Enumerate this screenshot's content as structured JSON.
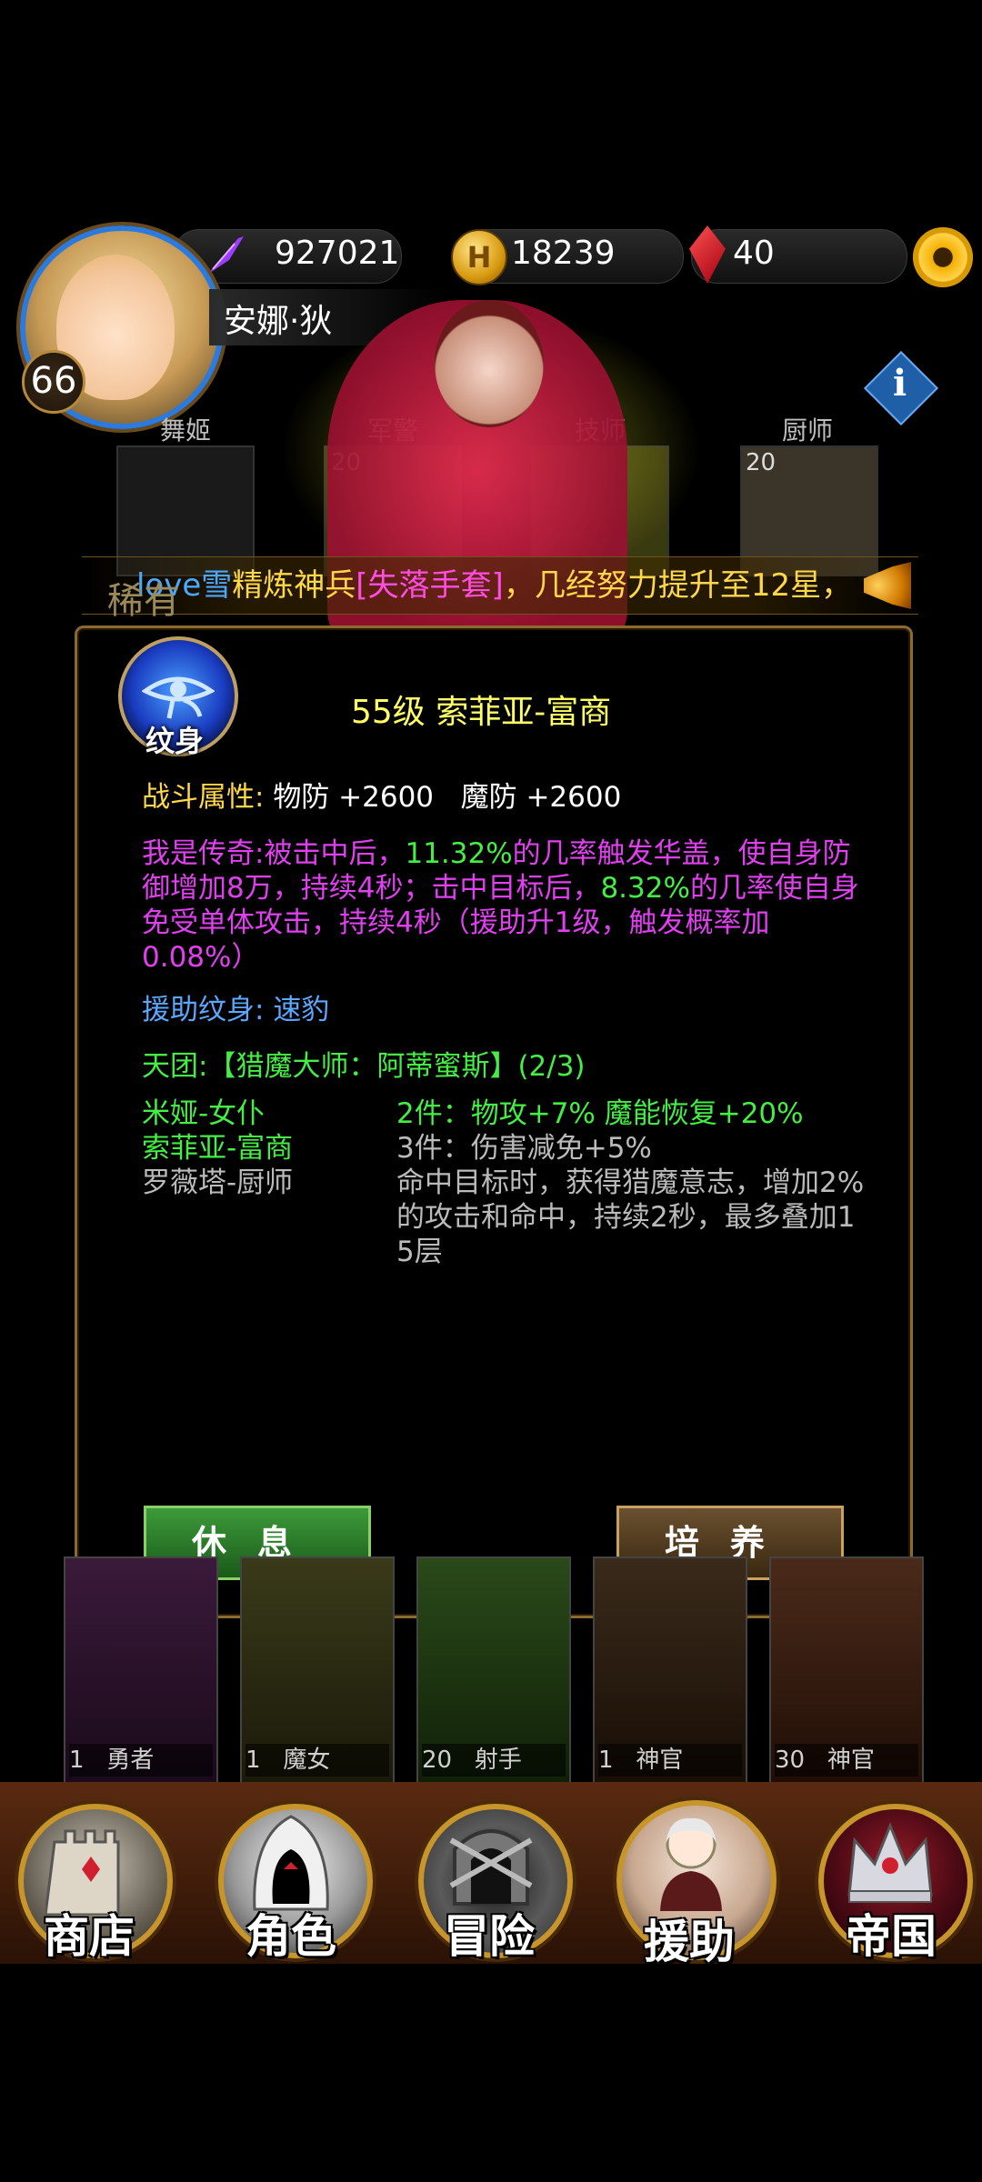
{
  "resources": {
    "power": "927021",
    "gold": "18239",
    "gold_icon_letter": "H",
    "gems": "40"
  },
  "player": {
    "name": "安娜·狄",
    "level": "66"
  },
  "hero_slots": [
    {
      "label": "舞姬",
      "level": ""
    },
    {
      "label": "军警",
      "level": "20"
    },
    {
      "label": "技师",
      "level": ""
    },
    {
      "label": "厨师",
      "level": "20"
    }
  ],
  "ticker": {
    "rarity": "稀有",
    "segments": [
      {
        "text": "love雪",
        "color": "#4aa8ff"
      },
      {
        "text": "精炼神兵",
        "color": "#ffd84a"
      },
      {
        "text": "[失落手套]",
        "color": "#ff4de0"
      },
      {
        "text": "，几经努力提升至12星，",
        "color": "#ffd84a"
      }
    ]
  },
  "panel": {
    "icon_label": "纹身",
    "title": "55级 索菲亚-富商",
    "battle_attr_label": "战斗属性:",
    "battle_attr_value": "物防 +2600   魔防 +2600",
    "legend": {
      "label": "我是传奇:",
      "segments": [
        {
          "text": "被击中后，",
          "color": "#e040f0"
        },
        {
          "text": "11.32%",
          "color": "#44ee44"
        },
        {
          "text": "的几率触发华盖，使自身防御增加8万，持续4秒；击中目标后，",
          "color": "#e040f0"
        },
        {
          "text": "8.32%",
          "color": "#44ee44"
        },
        {
          "text": "的几率使自身免受单体攻击，持续4秒（援助升1级，触发概率加0.08%）",
          "color": "#e040f0"
        }
      ]
    },
    "support_tattoo_label": "援助纹身:",
    "support_tattoo_value": "速豹",
    "team_title": "天团:【猎魔大师：阿蒂蜜斯】(2/3)",
    "members": [
      {
        "name": "米娅-女仆",
        "color": "#44ee44"
      },
      {
        "name": "索菲亚-富商",
        "color": "#44ee44"
      },
      {
        "name": "罗薇塔-厨师",
        "color": "#bbbbbb"
      }
    ],
    "bonuses": [
      {
        "text": "2件：物攻+7% 魔能恢复+20%",
        "color": "#44ee44"
      },
      {
        "text": "3件：伤害减免+5%",
        "color": "#bbbbbb"
      },
      {
        "text": "命中目标时，获得猎魔意志，增加2%的攻击和命中，持续2秒，最多叠加15层",
        "color": "#bbbbbb"
      }
    ],
    "rest_button": "休息",
    "train_button": "培养"
  },
  "bottom_heroes": [
    {
      "level": "1",
      "name": "勇者"
    },
    {
      "level": "1",
      "name": "魔女"
    },
    {
      "level": "20",
      "name": "射手"
    },
    {
      "level": "1",
      "name": "神官"
    },
    {
      "level": "30",
      "name": "神官"
    }
  ],
  "nav": [
    {
      "label": "商店",
      "icon": "castle-icon"
    },
    {
      "label": "角色",
      "icon": "hood-icon"
    },
    {
      "label": "冒险",
      "icon": "dungeon-icon"
    },
    {
      "label": "援助",
      "icon": "girl-portrait-icon"
    },
    {
      "label": "帝国",
      "icon": "crown-icon"
    }
  ]
}
